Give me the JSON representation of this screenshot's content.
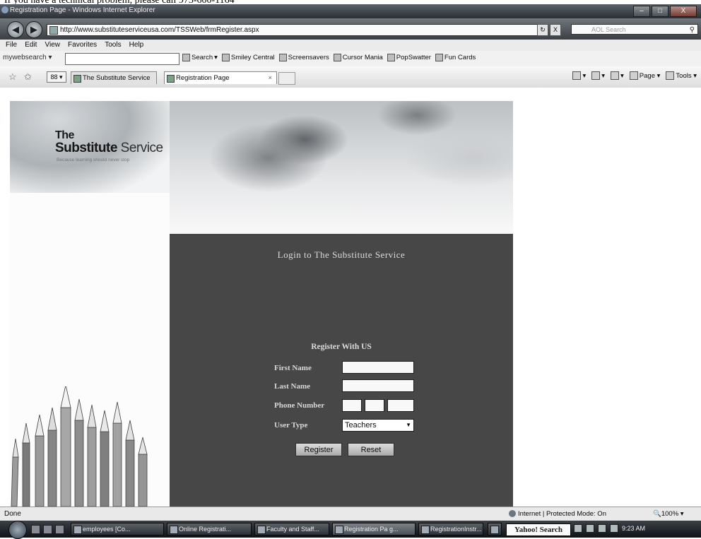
{
  "note": "If you have a technical problem, please call 973-600-1164",
  "window": {
    "title": "Registration Page - Windows Internet Explorer",
    "controls": [
      "–",
      "□",
      "X"
    ]
  },
  "address_bar": {
    "back": "◀",
    "forward": "▶",
    "url": "http://www.substituteserviceusa.com/TSSWeb/frmRegister.aspx",
    "refresh": "↻",
    "stop": "X",
    "search_placeholder": "AOL Search"
  },
  "menu": [
    "File",
    "Edit",
    "View",
    "Favorites",
    "Tools",
    "Help"
  ],
  "toolbar": {
    "label": "mywebsearch ▾",
    "search_button": "Search",
    "items": [
      "Smiley Central",
      "Screensavers",
      "Cursor Mania",
      "PopSwatter",
      "Fun Cards"
    ]
  },
  "tabs": {
    "quick_tabs": "88 ▾",
    "tab1": "The Substitute Service",
    "tab2": "Registration Page",
    "close": "×",
    "cmd": {
      "page": "Page ▾",
      "tools": "Tools ▾"
    }
  },
  "site": {
    "logo_the": "The",
    "logo_substitute": "Substitute",
    "logo_service": "Service",
    "tagline": "Because learning should never stop",
    "login_title": "Login to The Substitute Service",
    "register_title": "Register With US",
    "fields": {
      "first_name": "First Name",
      "last_name": "Last Name",
      "phone_number": "Phone Number",
      "user_type": "User Type"
    },
    "user_type_value": "Teachers",
    "buttons": {
      "register": "Register",
      "reset": "Reset"
    }
  },
  "status": {
    "done": "Done",
    "mode": "Internet | Protected Mode: On",
    "zoom": "100%"
  },
  "taskbar": {
    "buttons": [
      "employees [Co...",
      "Online Registrati...",
      "Faculty and Staff...",
      "Registration Pa g...",
      "RegistrationInstr..."
    ],
    "yahoo": "Yahoo! Search",
    "clock": "9:23 AM"
  }
}
